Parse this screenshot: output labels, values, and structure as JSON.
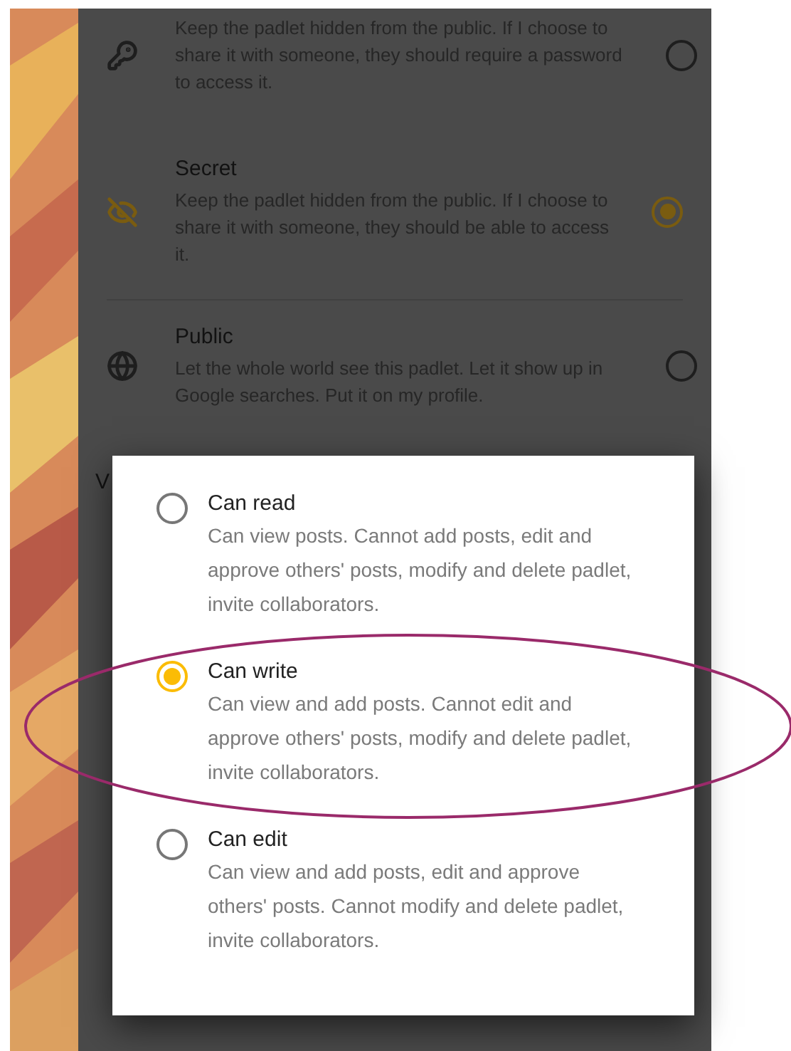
{
  "privacy_options": [
    {
      "kind": "password",
      "description": "Keep the padlet hidden from the public. If I choose to share it with someone, they should require a password to access it.",
      "selected": false
    },
    {
      "kind": "secret",
      "title": "Secret",
      "description": "Keep the padlet hidden from the public. If I choose to share it with someone, they should be able to access it.",
      "selected": true
    },
    {
      "kind": "public",
      "title": "Public",
      "description": "Let the whole world see this padlet. Let it show up in Google searches. Put it on my profile.",
      "selected": false
    }
  ],
  "partial_label": "V",
  "permission_dialog": {
    "options": [
      {
        "title": "Can read",
        "description": "Can view posts. Cannot add posts, edit and approve others' posts, modify and delete padlet, invite collaborators.",
        "selected": false
      },
      {
        "title": "Can write",
        "description": "Can view and add posts. Cannot edit and approve others' posts, modify and delete padlet, invite collaborators.",
        "selected": true
      },
      {
        "title": "Can edit",
        "description": "Can view and add posts, edit and approve others' posts. Cannot modify and delete padlet, invite collaborators.",
        "selected": false
      }
    ]
  }
}
